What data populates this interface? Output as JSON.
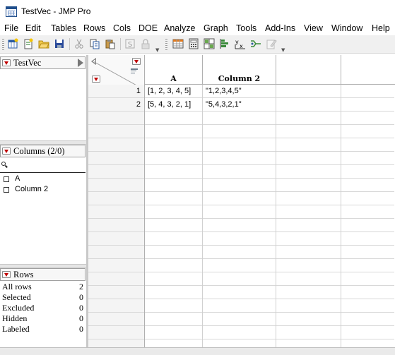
{
  "window": {
    "title": "TestVec - JMP Pro"
  },
  "menu": {
    "items": [
      "File",
      "Edit",
      "Tables",
      "Rows",
      "Cols",
      "DOE",
      "Analyze",
      "Graph",
      "Tools",
      "Add-Ins",
      "View",
      "Window",
      "Help"
    ]
  },
  "toolbar": {
    "icons": [
      "new-data-table-icon",
      "new-script-icon",
      "open-icon",
      "save-icon",
      "cut-icon",
      "copy-icon",
      "paste-icon",
      "script-icon",
      "lock-icon",
      "data-table-icon",
      "formula-icon",
      "tabulate-icon",
      "distribution-icon",
      "fit-y-by-x-icon",
      "fit-model-icon",
      "edit-icon"
    ]
  },
  "table_panel": {
    "name": "TestVec"
  },
  "columns_panel": {
    "header": "Columns (2/0)",
    "columns": [
      "A",
      "Column 2"
    ]
  },
  "rows_panel": {
    "header": "Rows",
    "stats": [
      {
        "label": "All rows",
        "value": "2"
      },
      {
        "label": "Selected",
        "value": "0"
      },
      {
        "label": "Excluded",
        "value": "0"
      },
      {
        "label": "Hidden",
        "value": "0"
      },
      {
        "label": "Labeled",
        "value": "0"
      }
    ]
  },
  "grid": {
    "column_headers": [
      "A",
      "Column 2"
    ],
    "row_numbers": [
      "1",
      "2"
    ],
    "rows": [
      [
        "[1, 2, 3, 4, 5]",
        "\"1,2,3,4,5\""
      ],
      [
        "[5, 4, 3, 2, 1]",
        "\"5,4,3,2,1\""
      ]
    ]
  }
}
